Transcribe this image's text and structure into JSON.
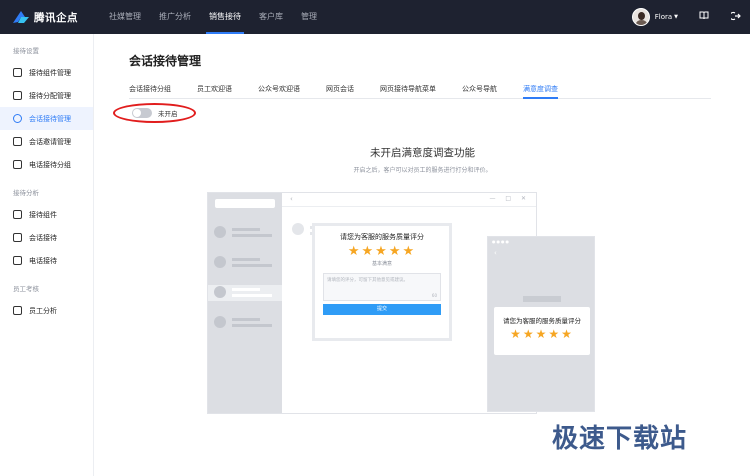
{
  "app": {
    "logo_text": "腾讯企点"
  },
  "nav": {
    "items": [
      {
        "label": "社媒管理"
      },
      {
        "label": "推广分析"
      },
      {
        "label": "销售接待"
      },
      {
        "label": "客户库"
      },
      {
        "label": "管理"
      }
    ],
    "active_index": 2
  },
  "user": {
    "name": "Flora"
  },
  "sidebar": {
    "groups": [
      {
        "title": "接待设置",
        "items": [
          "接待组件管理",
          "接待分配管理",
          "会话接待管理",
          "会话邀请管理",
          "电话接待分组"
        ]
      },
      {
        "title": "接待分析",
        "items": [
          "接待组件",
          "会话接待",
          "电话接待"
        ]
      },
      {
        "title": "员工考核",
        "items": [
          "员工分析"
        ]
      }
    ],
    "active_item": "会话接待管理"
  },
  "main": {
    "title": "会话接待管理",
    "tabs": [
      "会话接待分组",
      "员工欢迎语",
      "公众号欢迎语",
      "网页会话",
      "网页接待导航菜单",
      "公众号导航",
      "满意度调查"
    ],
    "active_tab": "满意度调查",
    "toggle": {
      "state": "off",
      "label": "未开启"
    },
    "empty": {
      "title": "未开启满意度调查功能",
      "subtitle": "开启之后，客户可以对员工的服务进行打分和评价。"
    },
    "illustration": {
      "card_title": "请您为客服的服务质量评分",
      "stars": "★★★★★",
      "rating_label": "基本满意",
      "input_placeholder": "请填您的评分，可留下其他意见或建议。",
      "counter": "60",
      "submit_label": "提交",
      "phone_card_title": "请您为客服的服务质量评分",
      "phone_stars": "★★★★★"
    }
  },
  "watermark": "极速下载站",
  "colors": {
    "accent": "#2f7cf6",
    "topbar": "#1e2230",
    "star": "#f6a623",
    "highlight": "#e11d1d"
  }
}
